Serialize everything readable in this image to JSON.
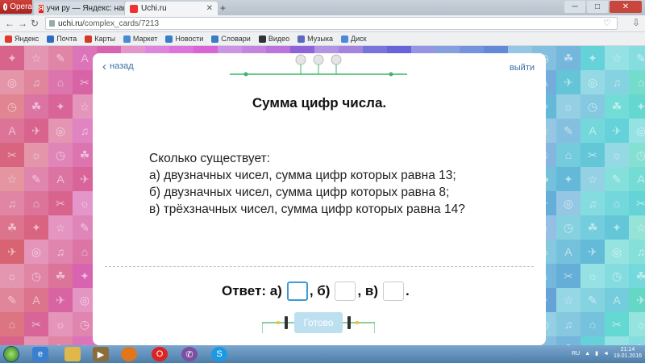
{
  "browser": {
    "menu_label": "Opera",
    "tabs": [
      {
        "title": "учи ру — Яндекс: нашло"
      },
      {
        "title": "Uchi.ru"
      }
    ],
    "new_tab_label": "+",
    "url_host": "uchi.ru",
    "url_path": "/complex_cards/7213",
    "bookmarks": [
      {
        "label": "Яндекс",
        "icon": "yandex-icon",
        "color": "#e03a2f"
      },
      {
        "label": "Почта",
        "icon": "mail-icon",
        "color": "#2e6ec0"
      },
      {
        "label": "Карты",
        "icon": "map-pin-icon",
        "color": "#d43a2a"
      },
      {
        "label": "Маркет",
        "icon": "cart-icon",
        "color": "#4a8ad6"
      },
      {
        "label": "Новости",
        "icon": "news-icon",
        "color": "#3a7cc8"
      },
      {
        "label": "Словари",
        "icon": "book-icon",
        "color": "#3a7cc8"
      },
      {
        "label": "Видео",
        "icon": "video-icon",
        "color": "#333333"
      },
      {
        "label": "Музыка",
        "icon": "music-icon",
        "color": "#5c6bc0"
      },
      {
        "label": "Диск",
        "icon": "disk-icon",
        "color": "#4a8ad6"
      }
    ]
  },
  "lesson": {
    "back_label": "назад",
    "exit_label": "выйти",
    "title": "Сумма цифр числа.",
    "question_lines": [
      "Сколько существует:",
      "а) двузначных чисел, сумма цифр которых равна 13;",
      "б) двузначных чисел, сумма цифр которых равна 8;",
      "в) трёхзначных чисел, сумма цифр которых равна 14?"
    ],
    "answer_label": "Ответ: а)",
    "part_b": ", б)",
    "part_c": ", в)",
    "end_dot": ".",
    "submit_label": "Готово"
  },
  "taskbar": {
    "lang": "RU",
    "time": "21:14",
    "date": "19.01.2016",
    "accent": "#4d7eaa"
  },
  "colors": {
    "link": "#3a6fa5",
    "accent_green": "#3db56a",
    "answer_focus": "#3d9bd6",
    "button": "#bde0f0"
  }
}
